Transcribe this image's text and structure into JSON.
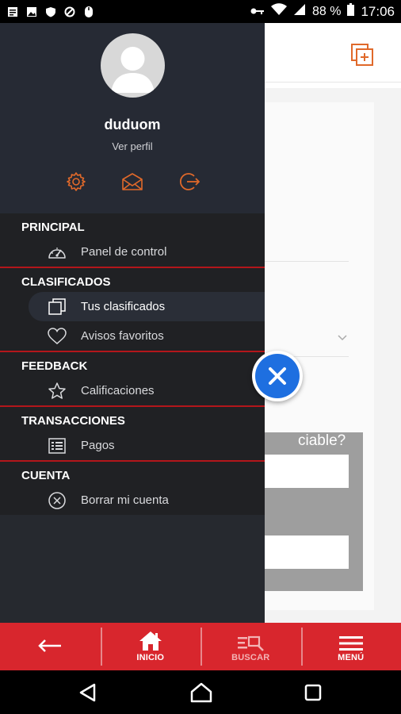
{
  "status_bar": {
    "battery": "88 %",
    "time": "17:06"
  },
  "background_page": {
    "question_text": "ciable?"
  },
  "drawer": {
    "username": "duduom",
    "view_profile": "Ver perfil",
    "icons": [
      "gear-icon",
      "mail-icon",
      "logout-icon"
    ],
    "accent_color": "#e0692a",
    "sections": [
      {
        "title": "PRINCIPAL",
        "items": [
          {
            "label": "Panel de control",
            "icon": "speedometer-icon"
          }
        ]
      },
      {
        "title": "CLASIFICADOS",
        "items": [
          {
            "label": "Tus clasificados",
            "icon": "copy-icon",
            "active": true
          },
          {
            "label": "Avisos favoritos",
            "icon": "heart-icon"
          }
        ]
      },
      {
        "title": "FEEDBACK",
        "items": [
          {
            "label": "Calificaciones",
            "icon": "star-icon"
          }
        ]
      },
      {
        "title": "TRANSACCIONES",
        "items": [
          {
            "label": "Pagos",
            "icon": "receipt-icon"
          }
        ]
      },
      {
        "title": "CUENTA",
        "items": [
          {
            "label": "Borrar mi cuenta",
            "icon": "close-circle-icon"
          }
        ]
      }
    ]
  },
  "bottom_bar": {
    "color": "#d8262d",
    "items": [
      {
        "label": "",
        "icon": "arrow-left-icon"
      },
      {
        "label": "INICIO",
        "icon": "home-icon"
      },
      {
        "label": "BUSCAR",
        "icon": "search-list-icon"
      },
      {
        "label": "MENÚ",
        "icon": "menu-icon"
      }
    ]
  }
}
